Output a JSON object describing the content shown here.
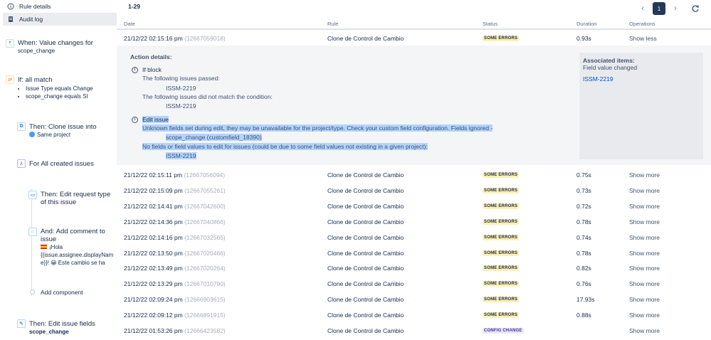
{
  "sidebar": {
    "nav": [
      {
        "label": "Rule details",
        "icon": "info-icon"
      },
      {
        "label": "Audit log",
        "icon": "document-icon",
        "active": true
      }
    ],
    "components": {
      "trigger": {
        "title": "When: Value changes for",
        "sub": "scope_change"
      },
      "condition": {
        "title": "If: all match",
        "items": [
          "Issue Type equals Change",
          "scope_change equals SI"
        ]
      },
      "clone": {
        "title": "Then: Clone issue into",
        "sub": "Same project"
      },
      "branch": {
        "title": "For All created issues"
      },
      "edit_request": {
        "title_1": "Then: Edit request type",
        "title_2": "of this issue"
      },
      "comment": {
        "title_1": "And: Add comment to",
        "title_2": "issue",
        "lines": [
          "¡Hola",
          "{{issue.assignee.displayNam",
          "e}}! 😀 Este cambio se ha"
        ]
      },
      "add_component": {
        "label": "Add component"
      },
      "edit_fields": {
        "title": "Then: Edit issue fields",
        "sub": "scope_change"
      }
    }
  },
  "header": {
    "range": "1-29",
    "current_page": "1"
  },
  "table": {
    "columns": {
      "date": "Date",
      "rule": "Rule",
      "status": "Status",
      "duration": "Duration",
      "operations": "Operations"
    },
    "rows": [
      {
        "date": "21/12/22 02:15:16 pm",
        "id": "(12667059018)",
        "rule": "Clone de Control de Cambio",
        "status": "SOME ERRORS",
        "duration": "0.93s",
        "op": "Show less"
      },
      {
        "date": "21/12/22 02:15:11 pm",
        "id": "(12667056094)",
        "rule": "Clone de Control de Cambio",
        "status": "SOME ERRORS",
        "duration": "0.75s",
        "op": "Show more"
      },
      {
        "date": "21/12/22 02:15:09 pm",
        "id": "(12667055261)",
        "rule": "Clone de Control de Cambio",
        "status": "SOME ERRORS",
        "duration": "0.73s",
        "op": "Show more"
      },
      {
        "date": "21/12/22 02:14:41 pm",
        "id": "(12667042600)",
        "rule": "Clone de Control de Cambio",
        "status": "SOME ERRORS",
        "duration": "0.72s",
        "op": "Show more"
      },
      {
        "date": "21/12/22 02:14:36 pm",
        "id": "(12667040866)",
        "rule": "Clone de Control de Cambio",
        "status": "SOME ERRORS",
        "duration": "0.78s",
        "op": "Show more"
      },
      {
        "date": "21/12/22 02:14:16 pm",
        "id": "(12667032565)",
        "rule": "Clone de Control de Cambio",
        "status": "SOME ERRORS",
        "duration": "0.74s",
        "op": "Show more"
      },
      {
        "date": "21/12/22 02:13:50 pm",
        "id": "(12667020466)",
        "rule": "Clone de Control de Cambio",
        "status": "SOME ERRORS",
        "duration": "0.78s",
        "op": "Show more"
      },
      {
        "date": "21/12/22 02:13:49 pm",
        "id": "(12667020264)",
        "rule": "Clone de Control de Cambio",
        "status": "SOME ERRORS",
        "duration": "0.82s",
        "op": "Show more"
      },
      {
        "date": "21/12/22 02:13:29 pm",
        "id": "(12667010790)",
        "rule": "Clone de Control de Cambio",
        "status": "SOME ERRORS",
        "duration": "0.76s",
        "op": "Show more"
      },
      {
        "date": "21/12/22 02:09:24 pm",
        "id": "(12666903615)",
        "rule": "Clone de Control de Cambio",
        "status": "SOME ERRORS",
        "duration": "17.93s",
        "op": "Show more"
      },
      {
        "date": "21/12/22 02:09:12 pm",
        "id": "(12666891915)",
        "rule": "Clone de Control de Cambio",
        "status": "SOME ERRORS",
        "duration": "0.88s",
        "op": "Show more"
      },
      {
        "date": "21/12/22 01:53:26 pm",
        "id": "(12666423582)",
        "rule": "Clone de Control de Cambio",
        "status": "CONFIG CHANGE",
        "duration": "",
        "op": "Show more"
      }
    ]
  },
  "details": {
    "header": "Action details:",
    "if_block": {
      "title": "If block",
      "passed_label": "The following issues passed:",
      "passed_issue": "ISSM-2219",
      "notmatch_label": "The following issues did not match the condition:",
      "notmatch_issue": "ISSM-2219"
    },
    "edit_issue": {
      "title": "Edit issue",
      "line1": "Unknown fields set during edit, they may be unavailable for the project/type. Check your custom field configuration. Fields ignored -",
      "line2": "scope_change (customfield_18390)",
      "line3": "No fields or field values to edit for issues (could be due to some field values not existing in a given project):",
      "line4": "ISSM-2219"
    },
    "associated": {
      "title": "Associated items:",
      "sub": "Field value changed",
      "link": "ISSM-2219"
    }
  },
  "colors": {
    "badge_error": "#fff0b3",
    "badge_config": "#eae6ff",
    "highlight": "#b3d4ff",
    "link": "#0052cc"
  }
}
